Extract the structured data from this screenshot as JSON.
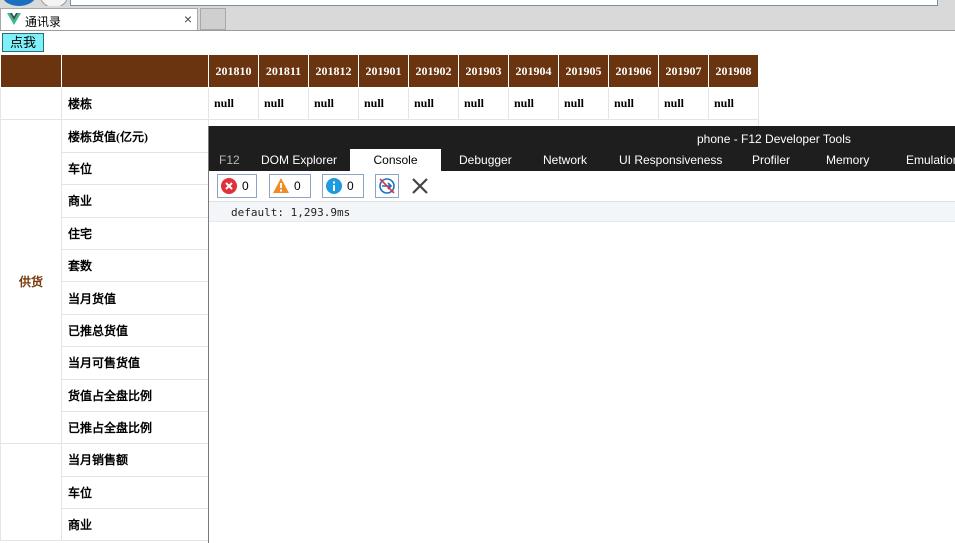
{
  "browser": {
    "tab_title": "通讯录",
    "tab_close": "×"
  },
  "page": {
    "click_button": "点我"
  },
  "table": {
    "months": [
      "201810",
      "201811",
      "201812",
      "201901",
      "201902",
      "201903",
      "201904",
      "201905",
      "201906",
      "201907",
      "201908"
    ],
    "building_row": {
      "label": "楼栋",
      "values": [
        "null",
        "null",
        "null",
        "null",
        "null",
        "null",
        "null",
        "null",
        "null",
        "null",
        "null"
      ]
    },
    "supply_group": {
      "label": "供货",
      "rows": [
        "楼栋货值(亿元)",
        "车位",
        "商业",
        "住宅",
        "套数",
        "当月货值",
        "已推总货值",
        "当月可售货值",
        "货值占全盘比例",
        "已推占全盘比例"
      ]
    },
    "sales_group": {
      "label": "",
      "rows": [
        "当月销售额",
        "车位",
        "商业"
      ]
    }
  },
  "devtools": {
    "title": "phone - F12 Developer Tools",
    "tabs": [
      "F12",
      "DOM Explorer",
      "Console",
      "Debugger",
      "Network",
      "UI Responsiveness",
      "Profiler",
      "Memory",
      "Emulation"
    ],
    "active_tab": "Console",
    "errors": "0",
    "warnings": "0",
    "infos": "0",
    "console_output": "default: 1,293.9ms",
    "colors": {
      "bar": "#1e1e1e",
      "error": "#e0303a",
      "warning": "#f08c28",
      "info": "#1e9be0"
    }
  }
}
